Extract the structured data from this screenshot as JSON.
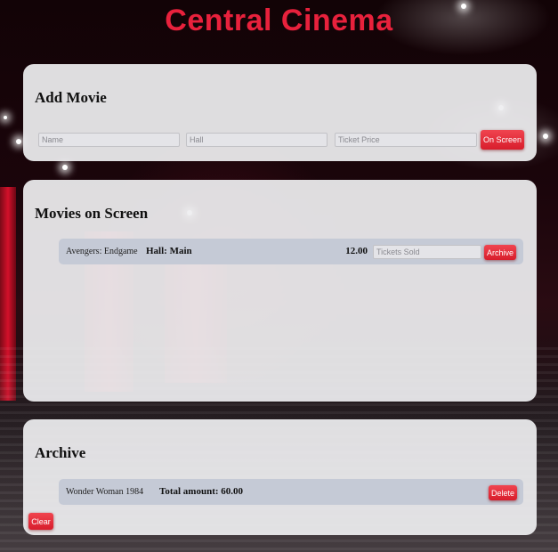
{
  "app": {
    "title": "Central Cinema"
  },
  "add_movie": {
    "heading": "Add Movie",
    "name_placeholder": "Name",
    "hall_placeholder": "Hall",
    "price_placeholder": "Ticket Price",
    "submit_label": "On Screen"
  },
  "on_screen": {
    "heading": "Movies on Screen",
    "movies": [
      {
        "name": "Avengers: Endgame",
        "hall_label": "Hall: Main",
        "price": "12.00",
        "tickets_placeholder": "Tickets Sold",
        "archive_label": "Archive"
      }
    ]
  },
  "archive": {
    "heading": "Archive",
    "items": [
      {
        "name": "Wonder Woman 1984",
        "total_label": "Total amount: 60.00",
        "delete_label": "Delete"
      }
    ],
    "clear_label": "Clear"
  },
  "colors": {
    "accent": "#e8213c",
    "button": "#e0262f",
    "panel": "#eeeef0",
    "row": "#c5cad6"
  }
}
